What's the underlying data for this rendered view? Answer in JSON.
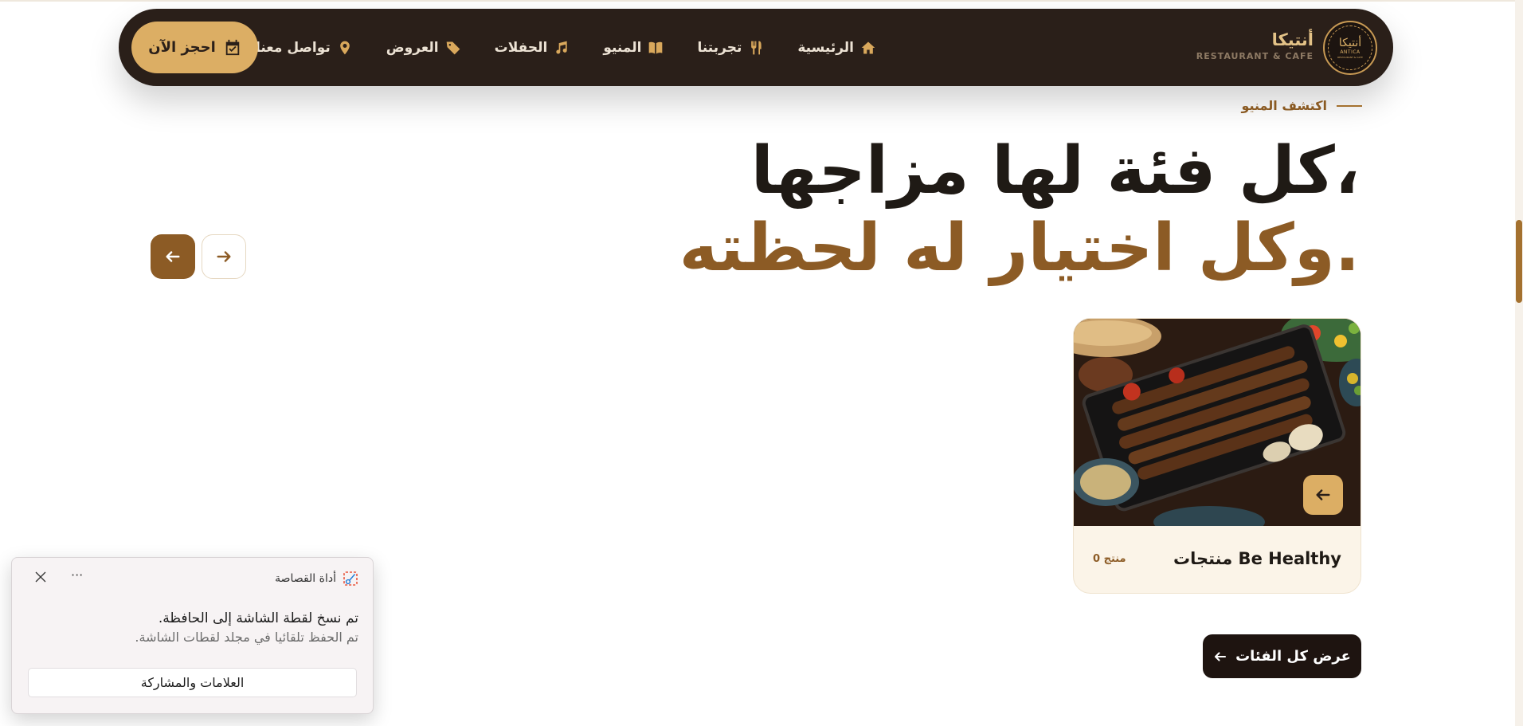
{
  "nav": {
    "brand_name": "أنتيكا",
    "brand_tagline": "RESTAURANT & CAFE",
    "logo": {
      "ar": "أنتيكا",
      "en": "ANTICA",
      "sub": "RESTAURANT & CAFE"
    },
    "items": [
      {
        "label": "الرئيسية",
        "icon": "home-icon"
      },
      {
        "label": "تجربتنا",
        "icon": "utensils-icon"
      },
      {
        "label": "المنيو",
        "icon": "book-icon"
      },
      {
        "label": "الحفلات",
        "icon": "music-icon"
      },
      {
        "label": "العروض",
        "icon": "tags-icon"
      },
      {
        "label": "تواصل معنا",
        "icon": "location-pin-icon"
      }
    ],
    "cta": {
      "label": "احجز الآن",
      "icon": "calendar-check-icon"
    }
  },
  "section": {
    "eyebrow": "اكتشف المنيو",
    "headline_line1": "كل فئة لها مزاجها،",
    "headline_line2": "وكل اختيار له لحظته.",
    "prev_icon": "arrow-left-icon",
    "next_icon": "arrow-right-icon"
  },
  "category_card": {
    "title": "منتجات Be Healthy",
    "count": "0 منتج",
    "image": "grilled-kebab-platter-image",
    "arrow_icon": "arrow-left-icon"
  },
  "view_all": {
    "label": "عرض كل الفئات",
    "icon": "arrow-left-icon"
  },
  "toast": {
    "app_name": "أداة القصاصة",
    "app_icon": "snipping-tool-icon",
    "message": "تم نسخ لقطة الشاشة إلى الحافظة.",
    "detail": "تم الحفظ تلقائيا في مجلد لقطات الشاشة.",
    "action_label": "العلامات والمشاركة",
    "more_label": "···"
  },
  "colors": {
    "nav_bg": "#2a1f19",
    "gold": "#dcae64",
    "brown": "#8c5b25",
    "dark": "#1e1410"
  }
}
